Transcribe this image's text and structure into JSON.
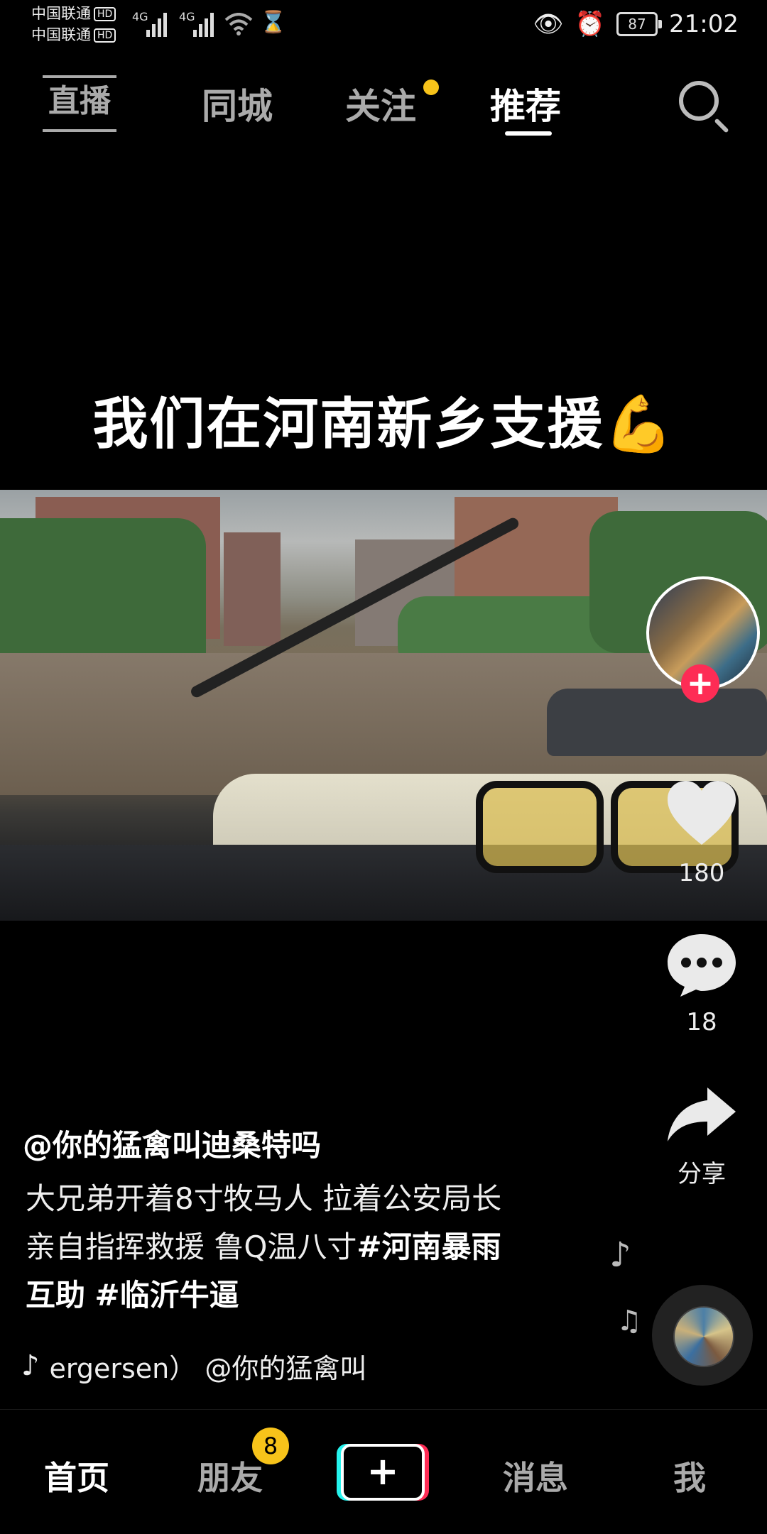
{
  "status_bar": {
    "carrier1": "中国联通",
    "carrier2": "中国联通",
    "hd": "HD",
    "network": "4G",
    "battery": "87",
    "time": "21:02"
  },
  "top_nav": {
    "live": "直播",
    "tabs": [
      {
        "label": "同城",
        "active": false
      },
      {
        "label": "关注",
        "active": false,
        "has_dot": true
      },
      {
        "label": "推荐",
        "active": true
      }
    ]
  },
  "video": {
    "caption": "我们在河南新乡支援",
    "caption_emoji": "💪"
  },
  "actions": {
    "likes": "180",
    "comments": "18",
    "share": "分享"
  },
  "post": {
    "author": "@你的猛禽叫迪桑特吗",
    "desc_line1": "大兄弟开着8寸牧马人 拉着公安局长",
    "desc_line2_plain": "亲自指挥救援 鲁Q温八寸",
    "hashtag1_part1": "#河南暴雨",
    "hashtag1_part2": "互助",
    "hashtag2": "#临沂牛逼",
    "music": "ergersen）     @你的猛禽叫"
  },
  "bottom_nav": {
    "home": "首页",
    "friends": "朋友",
    "friends_badge": "8",
    "add": "+",
    "messages": "消息",
    "me": "我"
  },
  "colors": {
    "accent_red": "#fe2c55",
    "accent_cyan": "#25f4ee",
    "badge_yellow": "#f7c31a"
  }
}
